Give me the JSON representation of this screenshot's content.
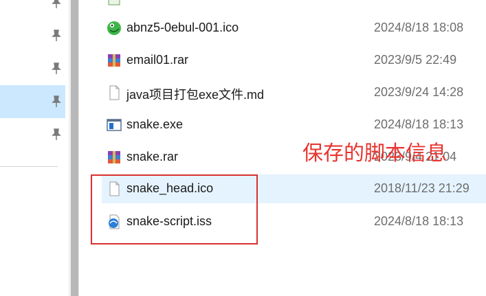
{
  "files": [
    {
      "name": "",
      "date": "",
      "icon": "notepad-icon",
      "partial": true
    },
    {
      "name": "abnz5-0ebul-001.ico",
      "date": "2024/8/18 18:08",
      "icon": "snake-app-icon"
    },
    {
      "name": "email01.rar",
      "date": "2023/9/5 22:49",
      "icon": "winrar-archive-icon"
    },
    {
      "name": "java项目打包exe文件.md",
      "date": "2023/9/24 14:28",
      "icon": "blank-file-icon"
    },
    {
      "name": "snake.exe",
      "date": "2024/8/18 18:13",
      "icon": "exe-window-icon"
    },
    {
      "name": "snake.rar",
      "date": "2023/9/4 21:04",
      "icon": "winrar-archive-icon"
    },
    {
      "name": "snake_head.ico",
      "date": "2018/11/23 21:29",
      "icon": "blank-file-icon",
      "hovered": true
    },
    {
      "name": "snake-script.iss",
      "date": "2024/8/18 18:13",
      "icon": "inno-setup-script-icon"
    }
  ],
  "annotation": {
    "text": "保存的脚本信息",
    "color": "#e8342f"
  },
  "colors": {
    "hover": "#e5f3ff",
    "selected": "#cce8ff",
    "annotation_border": "#d9302f"
  }
}
